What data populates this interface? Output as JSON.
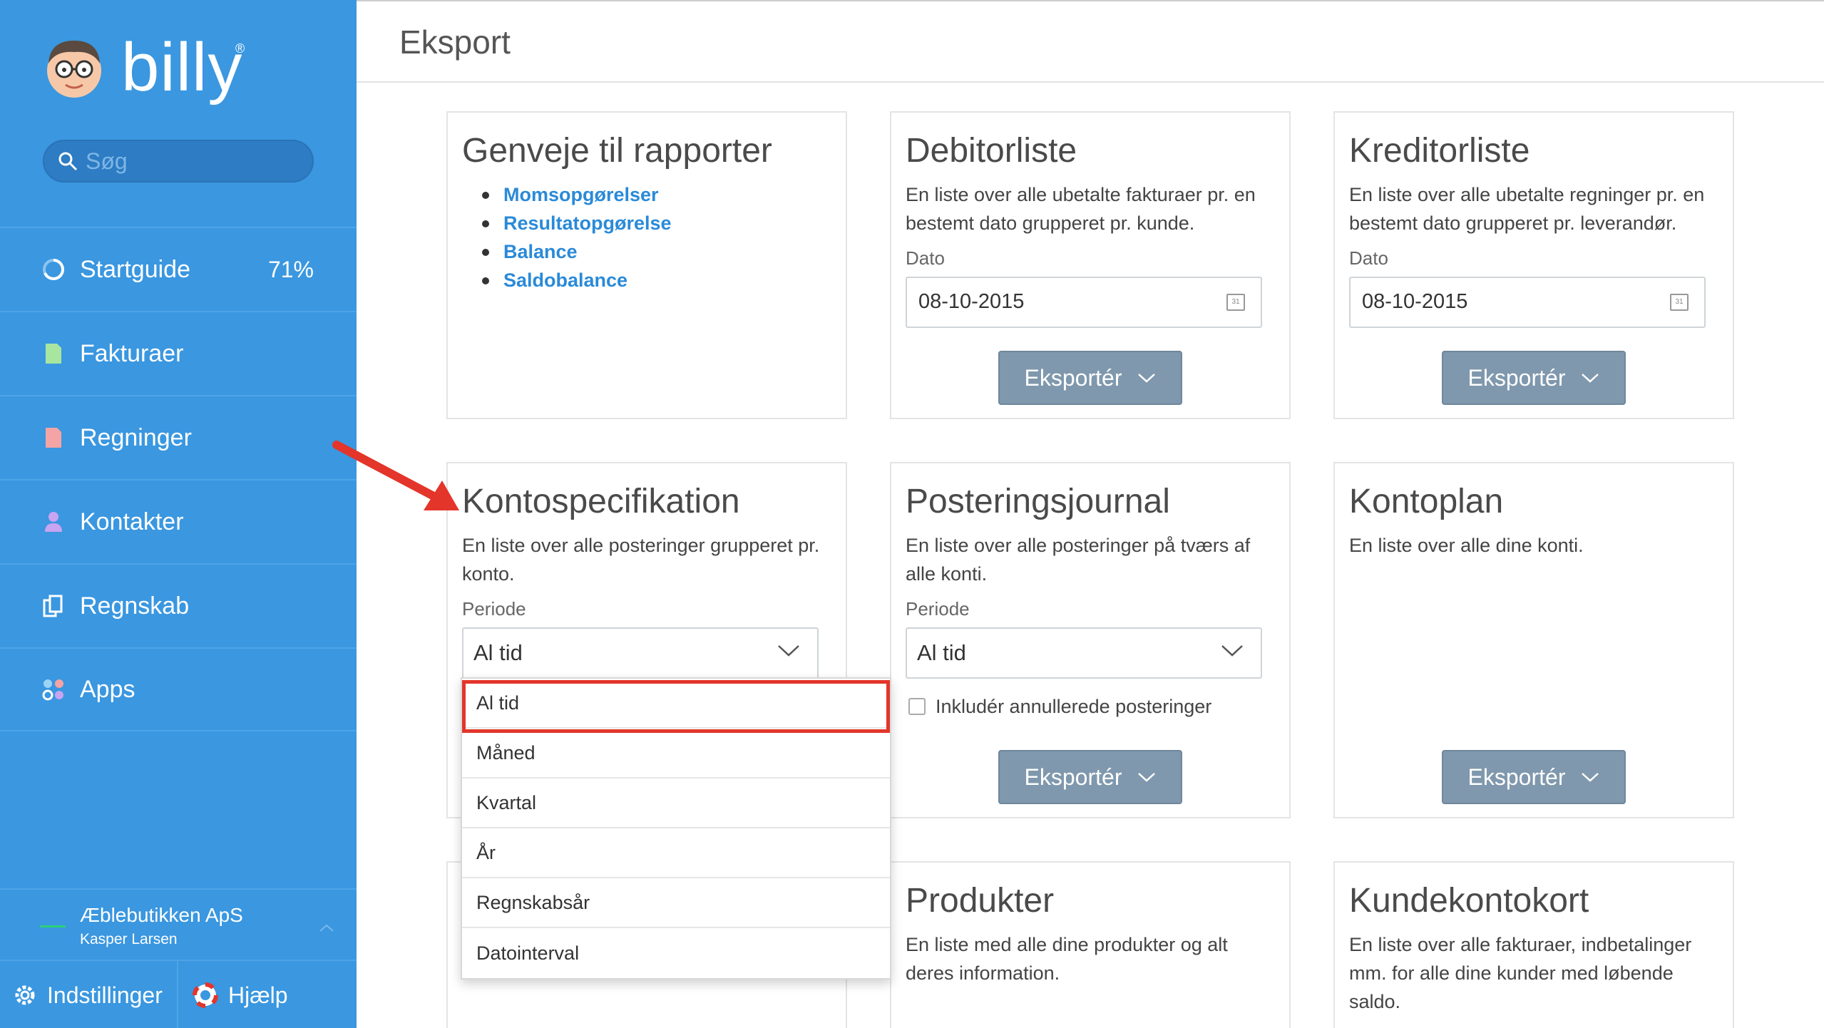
{
  "app": {
    "name": "billy",
    "reg": "®"
  },
  "search": {
    "placeholder": "Søg"
  },
  "sidebar": {
    "items": [
      {
        "label": "Startguide",
        "badge": "71%",
        "icon": "progress-ring-icon"
      },
      {
        "label": "Fakturaer",
        "icon": "document-green-icon"
      },
      {
        "label": "Regninger",
        "icon": "document-red-icon"
      },
      {
        "label": "Kontakter",
        "icon": "person-icon"
      },
      {
        "label": "Regnskab",
        "icon": "ledger-icon"
      },
      {
        "label": "Apps",
        "icon": "apps-icon"
      }
    ],
    "company": {
      "name": "Æblebutikken ApS",
      "user": "Kasper Larsen"
    },
    "footer": {
      "settings": "Indstillinger",
      "help": "Hjælp"
    }
  },
  "page": {
    "title": "Eksport"
  },
  "cards": {
    "shortcuts": {
      "title": "Genveje til rapporter",
      "links": [
        "Momsopgørelser",
        "Resultatopgørelse",
        "Balance",
        "Saldobalance"
      ]
    },
    "debitor": {
      "title": "Debitorliste",
      "desc": "En liste over alle ubetalte fakturaer pr. en bestemt dato grupperet pr. kunde.",
      "date_label": "Dato",
      "date": "08-10-2015",
      "export": "Eksportér"
    },
    "kreditor": {
      "title": "Kreditorliste",
      "desc": "En liste over alle ubetalte regninger pr. en bestemt dato grupperet pr. leverandør.",
      "date_label": "Dato",
      "date": "08-10-2015",
      "export": "Eksportér"
    },
    "kontospec": {
      "title": "Kontospecifikation",
      "desc": "En liste over alle posteringer grupperet pr. konto.",
      "period_label": "Periode",
      "period": "Al tid"
    },
    "posteringsjournal": {
      "title": "Posteringsjournal",
      "desc": "En liste over alle posteringer på tværs af alle konti.",
      "period_label": "Periode",
      "period": "Al tid",
      "checkbox": "Inkludér annullerede posteringer",
      "export": "Eksportér"
    },
    "kontoplan": {
      "title": "Kontoplan",
      "desc": "En liste over alle dine konti.",
      "export": "Eksportér"
    },
    "produkter": {
      "title": "Produkter",
      "desc": "En liste med alle dine produkter og alt deres information."
    },
    "kundekontokort": {
      "title": "Kundekontokort",
      "desc": "En liste over alle fakturaer, indbetalinger mm. for alle dine kunder med løbende saldo."
    }
  },
  "dropdown": {
    "options": [
      "Al tid",
      "Måned",
      "Kvartal",
      "År",
      "Regnskabsår",
      "Datointerval"
    ],
    "selected": "Al tid"
  },
  "colors": {
    "sidebar": "#3a97e0",
    "export_button": "#7f98ad",
    "link": "#2a8ad8",
    "highlight": "#e3352a"
  }
}
